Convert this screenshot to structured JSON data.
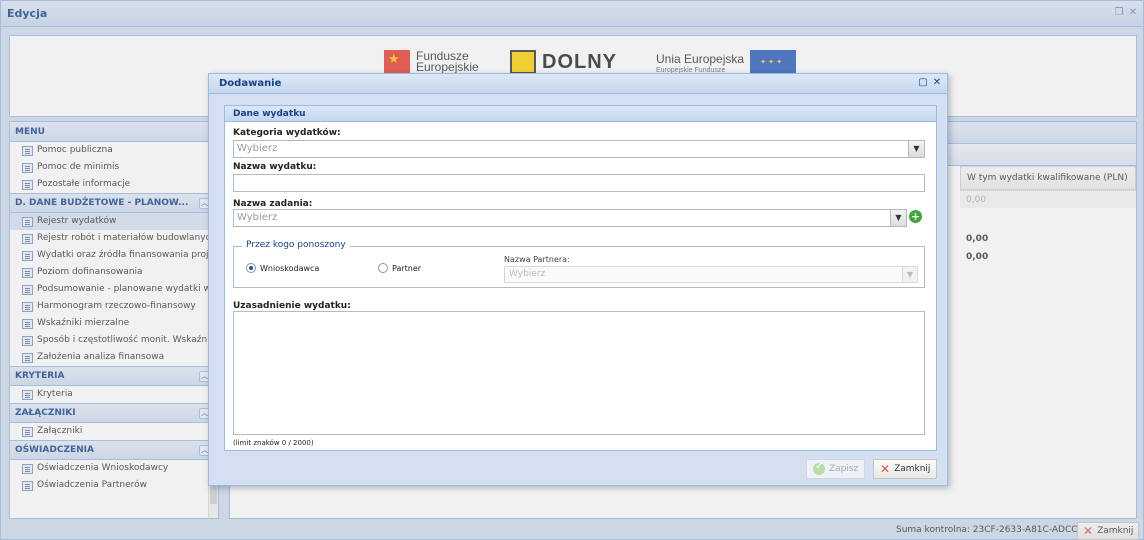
{
  "window": {
    "title": "Edycja"
  },
  "banner": {
    "fe_line1": "Fundusze",
    "fe_line2": "Europejskie",
    "ds_name": "DOLNY",
    "ue_line1": "Unia Europejska",
    "ue_line2": "Europejskie Fundusze"
  },
  "menu": {
    "header": "MENU",
    "top_items": [
      "Pomoc publiczna",
      "Pomoc de minimis",
      "Pozostałe informacje"
    ],
    "sections": [
      {
        "title": "D. DANE BUDŻETOWE - PLANOW...",
        "items": [
          "Rejestr wydatków",
          "Rejestr robót i materiałów budowlanych",
          "Wydatki oraz źródła finansowania projektu",
          "Poziom dofinansowania",
          "Podsumowanie - planowane wydatki w",
          "Harmonogram rzeczowo-finansowy",
          "Wskaźniki mierzalne",
          "Sposób i częstotliwość monit. Wskaźni",
          "Założenia analiza finansowa"
        ],
        "selected_index": 0
      },
      {
        "title": "KRYTERIA",
        "items": [
          "Kryteria"
        ]
      },
      {
        "title": "ZAŁĄCZNIKI",
        "items": [
          "Załączniki"
        ]
      },
      {
        "title": "OŚWIADCZENIA",
        "items": [
          "Oświadczenia Wnioskodawcy",
          "Oświadczenia Partnerów"
        ]
      }
    ]
  },
  "grid": {
    "column_header": "W tym wydatki kwalifikowane (PLN)",
    "rows": [
      "0,00",
      "0,00",
      "0,00"
    ]
  },
  "footer": {
    "checksum": "Suma kontrolna: 23CF-2633-A81C-ADCC",
    "close_label": "Zamknij"
  },
  "modal": {
    "title": "Dodawanie",
    "fieldset_title": "Dane wydatku",
    "category": {
      "label": "Kategoria wydatków:",
      "value": "Wybierz"
    },
    "name": {
      "label": "Nazwa wydatku:",
      "value": ""
    },
    "task": {
      "label": "Nazwa zadania:",
      "value": "Wybierz"
    },
    "incurred_by": {
      "legend": "Przez kogo ponoszony",
      "options": [
        "Wnioskodawca",
        "Partner"
      ],
      "selected": "Wnioskodawca",
      "partner_label": "Nazwa Partnera:",
      "partner_value": "Wybierz"
    },
    "justification": {
      "label": "Uzasadnienie wydatku:",
      "limit": "(limit znaków 0 / 2000)"
    },
    "buttons": {
      "save": "Zapisz",
      "close": "Zamknij"
    }
  }
}
